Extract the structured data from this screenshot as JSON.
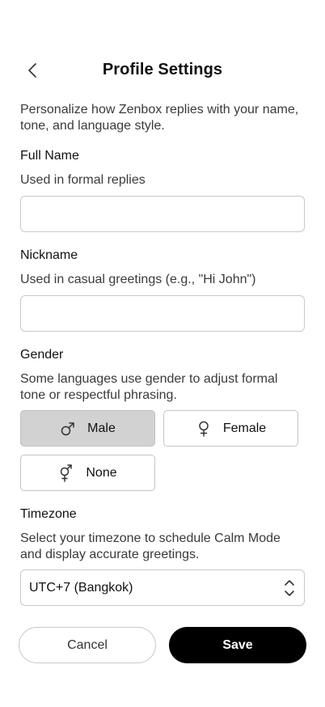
{
  "header": {
    "title": "Profile Settings",
    "back_icon": "chevron-left-icon"
  },
  "intro": "Personalize how Zenbox replies with your name, tone, and language style.",
  "full_name": {
    "label": "Full Name",
    "helper": "Used in formal replies",
    "value": "",
    "placeholder": ""
  },
  "nickname": {
    "label": "Nickname",
    "helper": "Used in casual greetings (e.g., \"Hi John\")",
    "value": "",
    "placeholder": ""
  },
  "gender": {
    "label": "Gender",
    "helper": "Some languages use gender to adjust formal tone or respectful phrasing.",
    "options": [
      {
        "label": "Male",
        "icon": "male-symbol-icon",
        "selected": true
      },
      {
        "label": "Female",
        "icon": "female-symbol-icon",
        "selected": false
      },
      {
        "label": "None",
        "icon": "neutral-gender-symbol-icon",
        "selected": false
      }
    ]
  },
  "timezone": {
    "label": "Timezone",
    "helper": "Select your timezone to schedule Calm Mode and display accurate greetings.",
    "selected": "UTC+7 (Bangkok)",
    "icon": "select-chevrons-icon"
  },
  "actions": {
    "cancel_label": "Cancel",
    "save_label": "Save"
  },
  "colors": {
    "primary": "#000000",
    "selected_option_bg": "#d2d2d2",
    "border": "#c9c9c9"
  }
}
